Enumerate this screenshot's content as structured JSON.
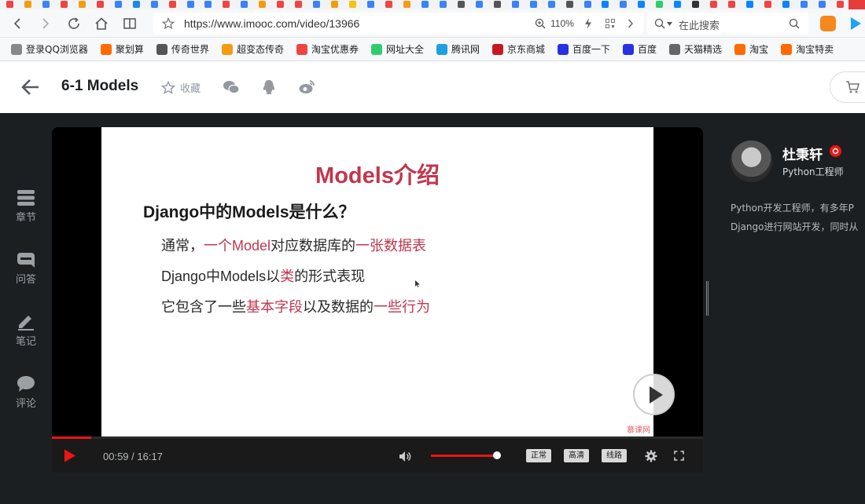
{
  "browser": {
    "url": "https://www.imooc.com/video/13966",
    "zoom": "110%",
    "search_placeholder": "在此搜索",
    "tab_icon_colors": [
      "#e44",
      "#f39c12",
      "#3b82f6",
      "#e44",
      "#f39c12",
      "#e44",
      "#3b82f6",
      "#1e88e5",
      "#3b82f6",
      "#e44",
      "#3b82f6",
      "#3b82f6",
      "#e44",
      "#3b82f6",
      "#f39c12",
      "#e44",
      "#e44",
      "#3b82f6",
      "#f39c12",
      "#f1c40f",
      "#3b82f6",
      "#e44",
      "#f39c12",
      "#3b82f6",
      "#3b82f6",
      "#555",
      "#3b82f6",
      "#555",
      "#3b82f6",
      "#3b82f6",
      "#3b82f6",
      "#555",
      "#3b82f6",
      "#0a84ff",
      "#3b82f6",
      "#0a84ff",
      "#2ecc71",
      "#0a84ff",
      "#333",
      "#e44",
      "#e44",
      "#0a84ff",
      "#e44",
      "#0a84ff",
      "#3b82f6",
      "#3b82f6",
      "#e44"
    ],
    "bookmarks": [
      {
        "label": "登录QQ浏览器",
        "icon": "user-icon",
        "color": "#888"
      },
      {
        "label": "聚划算",
        "icon": "taobao-icon",
        "color": "#ff6a00"
      },
      {
        "label": "传奇世界",
        "icon": "game-icon",
        "color": "#555"
      },
      {
        "label": "超变态传奇",
        "icon": "game-icon",
        "color": "#f39c12"
      },
      {
        "label": "淘宝优惠券",
        "icon": "coupon-icon",
        "color": "#e44"
      },
      {
        "label": "网址大全",
        "icon": "hao-icon",
        "color": "#2ecc71"
      },
      {
        "label": "腾讯网",
        "icon": "tencent-icon",
        "color": "#1ea0e0"
      },
      {
        "label": "京东商城",
        "icon": "jd-icon",
        "color": "#c91623"
      },
      {
        "label": "百度一下",
        "icon": "baidu-icon",
        "color": "#2932e1"
      },
      {
        "label": "百度",
        "icon": "baidu-icon",
        "color": "#2932e1"
      },
      {
        "label": "天猫精选",
        "icon": "globe-icon",
        "color": "#666"
      },
      {
        "label": "淘宝",
        "icon": "taobao-icon",
        "color": "#ff6a00"
      },
      {
        "label": "淘宝特卖",
        "icon": "taobao-icon",
        "color": "#ff6a00"
      }
    ]
  },
  "header": {
    "title": "6-1 Models",
    "favorite_label": "收藏"
  },
  "sidebar": {
    "items": [
      {
        "label": "章节",
        "icon": "chapters-icon"
      },
      {
        "label": "问答",
        "icon": "qa-icon"
      },
      {
        "label": "笔记",
        "icon": "notes-icon"
      },
      {
        "label": "评论",
        "icon": "comments-icon"
      }
    ]
  },
  "slide": {
    "title": "Models介绍",
    "question": "Django中的Models是什么？",
    "lines": [
      [
        {
          "t": "通常，",
          "hl": false
        },
        {
          "t": "一个Model",
          "hl": true
        },
        {
          "t": "对应数据库的",
          "hl": false
        },
        {
          "t": "一张数据表",
          "hl": true
        }
      ],
      [
        {
          "t": "Django中Models以",
          "hl": false
        },
        {
          "t": "类",
          "hl": true
        },
        {
          "t": "的形式表现",
          "hl": false
        }
      ],
      [
        {
          "t": "它包含了一些",
          "hl": false
        },
        {
          "t": "基本字段",
          "hl": true
        },
        {
          "t": "以及数据的",
          "hl": false
        },
        {
          "t": "一些行为",
          "hl": true
        }
      ]
    ],
    "watermark": "慕课网"
  },
  "player": {
    "current_time": "00:59",
    "duration": "16:17",
    "time_display": "00:59 / 16:17",
    "progress_fraction": 0.06,
    "volume_fraction": 0.95,
    "quality_buttons": [
      "正常",
      "高清",
      "线路"
    ],
    "accent_color": "#f01414"
  },
  "teacher": {
    "name": "杜秉轩",
    "title": "Python工程师",
    "desc_line1": "Python开发工程师，有多年P",
    "desc_line2": "Django进行网站开发，同时从"
  }
}
